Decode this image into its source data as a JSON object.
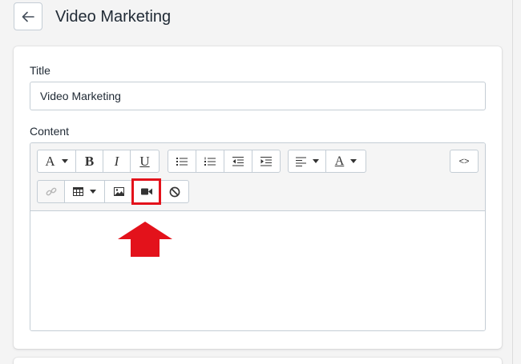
{
  "header": {
    "title": "Video Marketing",
    "back_icon": "arrow-left-icon"
  },
  "form": {
    "title_label": "Title",
    "title_value": "Video Marketing",
    "content_label": "Content"
  },
  "toolbar": {
    "font_style_glyph": "A",
    "bold_glyph": "B",
    "italic_glyph": "I",
    "underline_glyph": "U",
    "color_glyph": "A",
    "code_view_glyph": "<>",
    "icons": [
      "font-style-icon",
      "bold-icon",
      "italic-icon",
      "underline-icon",
      "unordered-list-icon",
      "ordered-list-icon",
      "outdent-icon",
      "indent-icon",
      "align-icon",
      "text-color-icon",
      "code-view-icon",
      "link-icon",
      "table-icon",
      "image-icon",
      "video-icon",
      "clear-format-icon"
    ]
  },
  "annotation": {
    "highlight_color": "#e3121b",
    "points_to": "video-icon"
  }
}
